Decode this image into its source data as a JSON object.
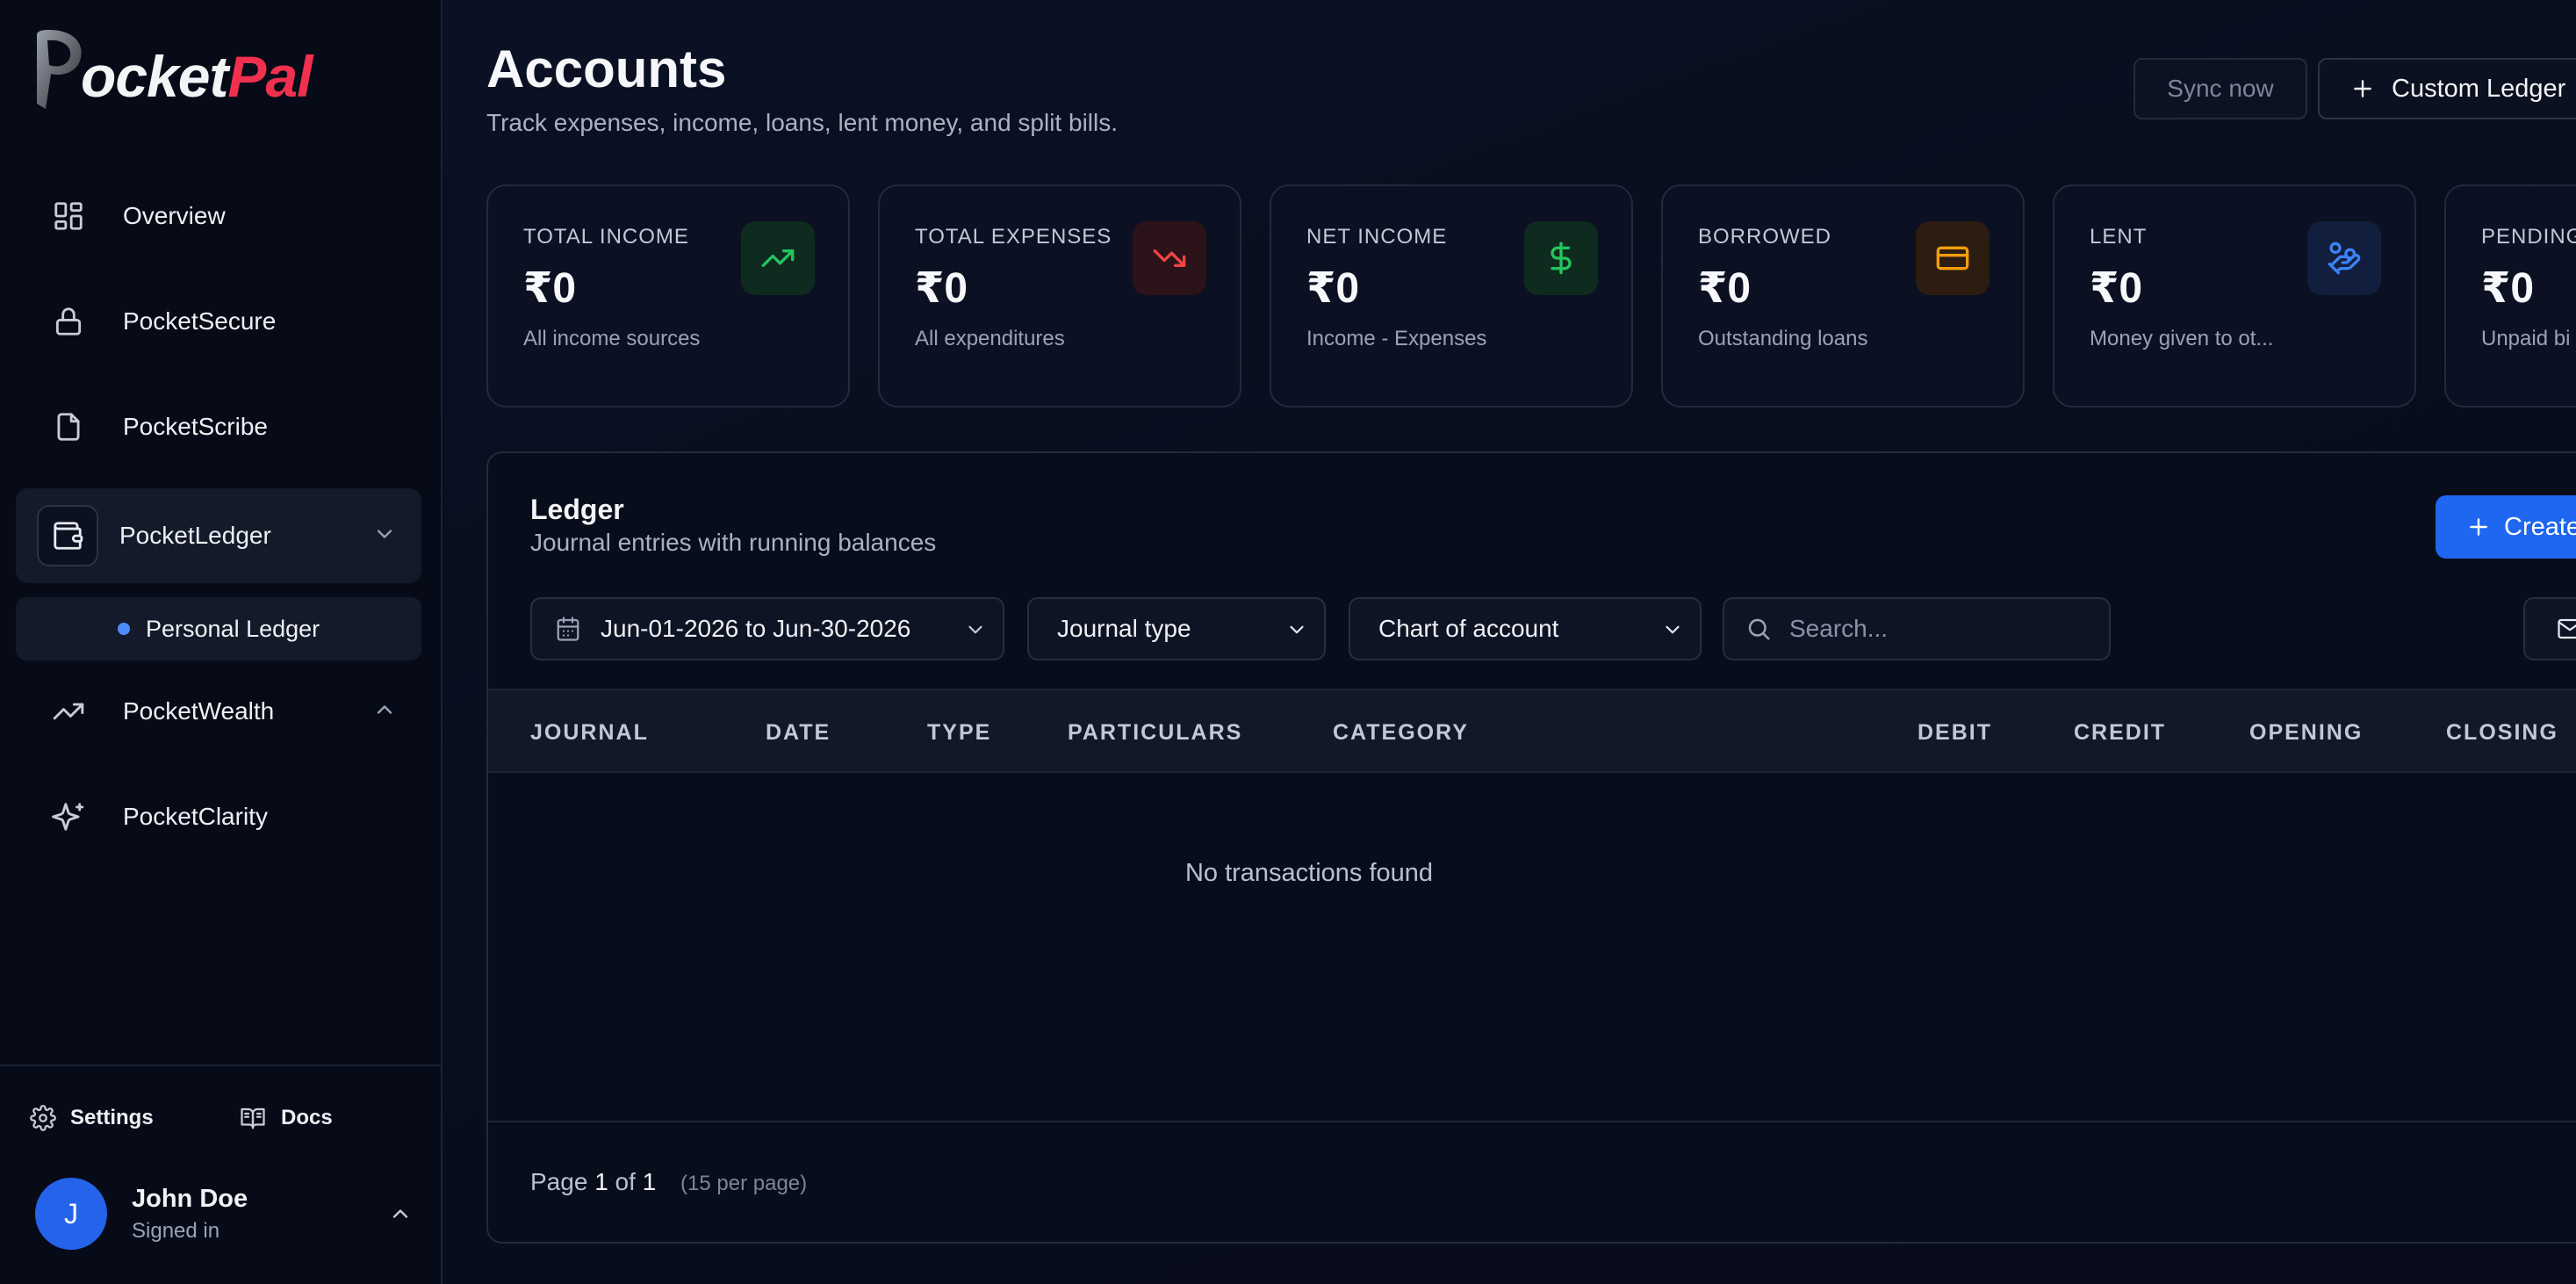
{
  "app": {
    "brand_part1": "ocket",
    "brand_part2": "Pal"
  },
  "sidebar": {
    "items": [
      {
        "label": "Overview",
        "icon": "grid-icon"
      },
      {
        "label": "PocketSecure",
        "icon": "lock-icon"
      },
      {
        "label": "PocketScribe",
        "icon": "file-icon"
      },
      {
        "label": "PocketLedger",
        "icon": "wallet-icon",
        "active": true,
        "expanded": true
      },
      {
        "label": "PocketWealth",
        "icon": "trending-up-icon",
        "expanded": false
      },
      {
        "label": "PocketClarity",
        "icon": "sparkles-icon"
      }
    ],
    "subitems": [
      {
        "label": "Personal Ledger"
      }
    ],
    "settings_label": "Settings",
    "docs_label": "Docs",
    "user": {
      "initial": "J",
      "name": "John Doe",
      "status": "Signed in"
    }
  },
  "header": {
    "title": "Accounts",
    "subtitle": "Track expenses, income, loans, lent money, and split bills.",
    "sync_label": "Sync now",
    "custom_ledger_label": "Custom Ledger"
  },
  "cards": [
    {
      "title": "TOTAL INCOME",
      "value": "₹0",
      "sub": "All income sources",
      "icon": "trending-up-icon",
      "color": "#22c55e",
      "bg": "#0f2a1e"
    },
    {
      "title": "TOTAL EXPENSES",
      "value": "₹0",
      "sub": "All expenditures",
      "icon": "trending-down-icon",
      "color": "#ef4444",
      "bg": "#2c1219"
    },
    {
      "title": "NET INCOME",
      "value": "₹0",
      "sub": "Income - Expenses",
      "icon": "dollar-icon",
      "color": "#22c55e",
      "bg": "#0f2a1e"
    },
    {
      "title": "BORROWED",
      "value": "₹0",
      "sub": "Outstanding loans",
      "icon": "credit-card-icon",
      "color": "#f59e0b",
      "bg": "#2c1d10"
    },
    {
      "title": "LENT",
      "value": "₹0",
      "sub": "Money given to ot...",
      "icon": "hand-coins-icon",
      "color": "#3b82f6",
      "bg": "#121e3d"
    },
    {
      "title": "PENDING",
      "value": "₹0",
      "sub": "Unpaid bi",
      "icon": "",
      "color": "#a855f7",
      "bg": "#221536"
    }
  ],
  "ledger": {
    "title": "Ledger",
    "subtitle": "Journal entries with running balances",
    "create_label": "Create",
    "date_range": "Jun-01-2026 to Jun-30-2026",
    "journal_type": "Journal type",
    "chart_of_account": "Chart of account",
    "search_placeholder": "Search...",
    "columns": [
      "JOURNAL",
      "DATE",
      "TYPE",
      "PARTICULARS",
      "CATEGORY",
      "DEBIT",
      "CREDIT",
      "OPENING",
      "CLOSING"
    ],
    "empty_text": "No transactions found",
    "pager": {
      "prefix": "Page",
      "current": "1",
      "of": "of",
      "total": "1",
      "per_page": "(15 per page)"
    }
  }
}
